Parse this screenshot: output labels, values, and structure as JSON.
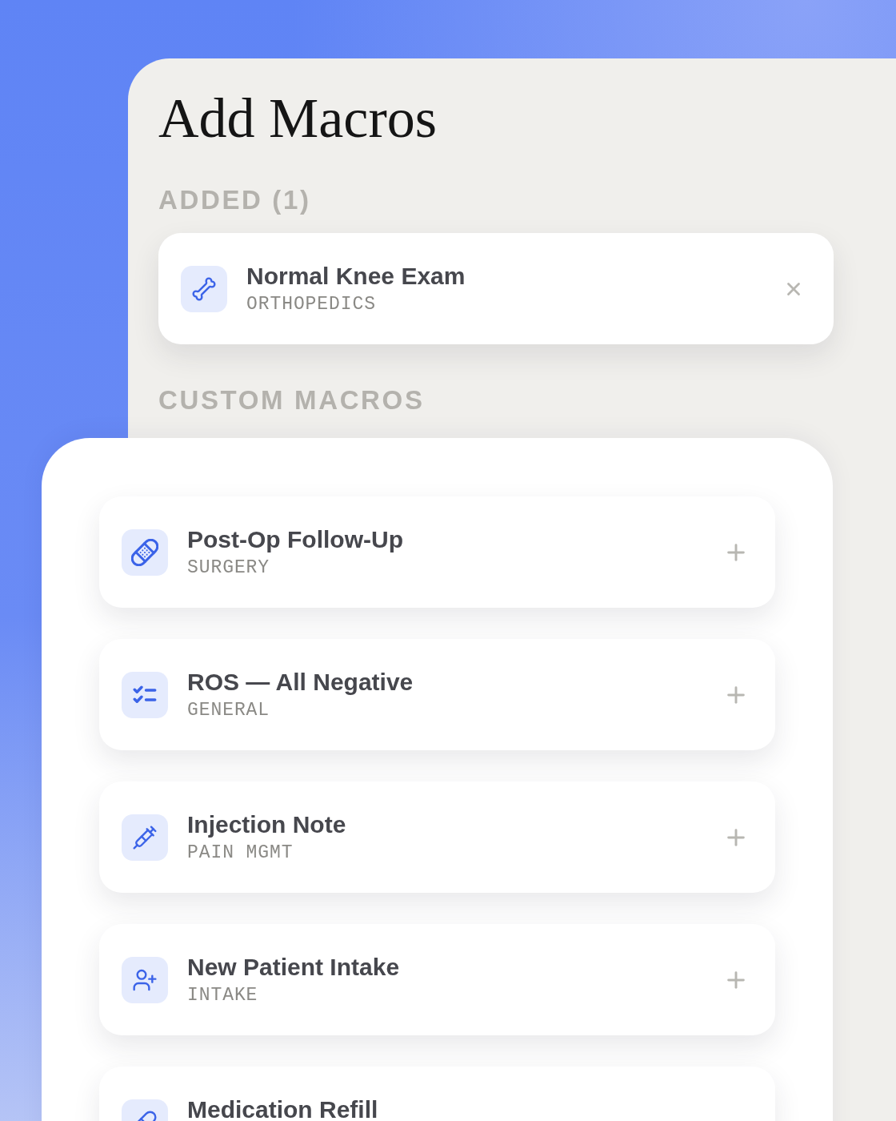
{
  "title": "Add Macros",
  "added": {
    "heading": "ADDED (1)",
    "items": [
      {
        "kind": "removable",
        "name": "Normal Knee Exam",
        "category": "ORTHOPEDICS"
      }
    ]
  },
  "custom": {
    "heading": "CUSTOM MACROS",
    "items": [
      {
        "kind": "addable",
        "name": "Post-Op Follow-Up",
        "category": "SURGERY"
      },
      {
        "kind": "addable",
        "name": "ROS — All Negative",
        "category": "GENERAL"
      },
      {
        "kind": "addable",
        "name": "Injection Note",
        "category": "PAIN MGMT"
      },
      {
        "kind": "addable",
        "name": "New Patient Intake",
        "category": "INTAKE"
      },
      {
        "kind": "plain",
        "name": "Medication Refill"
      }
    ]
  }
}
